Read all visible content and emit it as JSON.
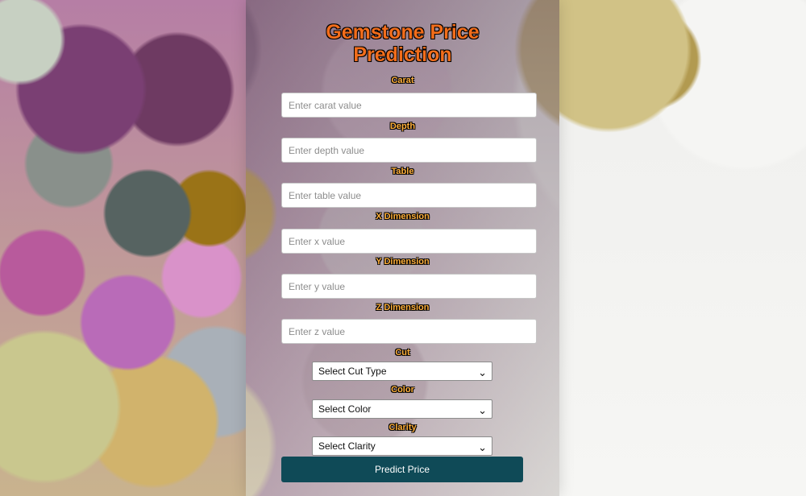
{
  "title": "Gemstone Price\nPrediction",
  "fields": [
    {
      "label": "Carat",
      "placeholder": "Enter carat value"
    },
    {
      "label": "Depth",
      "placeholder": "Enter depth value"
    },
    {
      "label": "Table",
      "placeholder": "Enter table value"
    },
    {
      "label": "X Dimension",
      "placeholder": "Enter x value"
    },
    {
      "label": "Y Dimension",
      "placeholder": "Enter y value"
    },
    {
      "label": "Z Dimension",
      "placeholder": "Enter z value"
    }
  ],
  "selects": [
    {
      "label": "Cut",
      "value": "Select Cut Type"
    },
    {
      "label": "Color",
      "value": "Select Color"
    },
    {
      "label": "Clarity",
      "value": "Select Clarity"
    }
  ],
  "button": {
    "label": "Predict Price"
  },
  "icons": {
    "dropdown": "chevron-down-icon"
  }
}
